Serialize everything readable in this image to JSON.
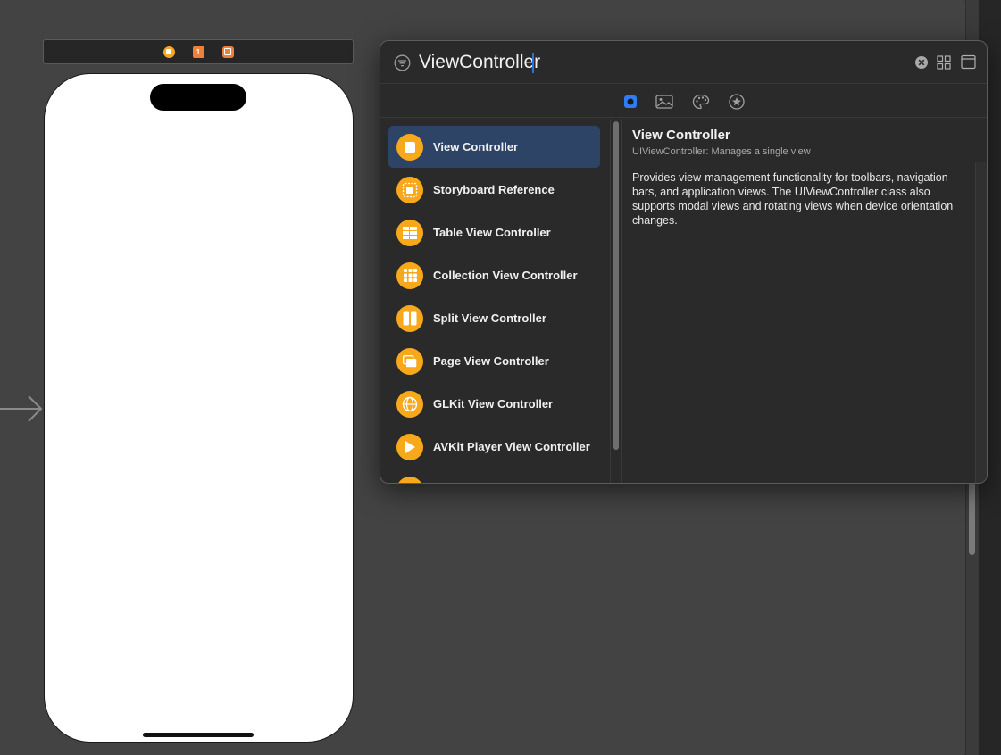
{
  "colors": {
    "accent": "#2f6fe0",
    "selection": "#2d4466",
    "object_icon": "#f7a81b",
    "canvas": "#434343",
    "panel": "#2a2a2a"
  },
  "scene_dock": {
    "icons": [
      "view-controller-icon",
      "first-responder-icon",
      "exit-icon"
    ],
    "first_responder_glyph": "1"
  },
  "library": {
    "search": {
      "value": "ViewController",
      "icon": "filter-icon"
    },
    "header_icons": [
      "clear-icon",
      "grid-icon",
      "panel-icon"
    ],
    "tabs": [
      {
        "name": "objects",
        "icon": "objects-icon",
        "active": true
      },
      {
        "name": "media",
        "icon": "photo-icon",
        "active": false
      },
      {
        "name": "colors",
        "icon": "palette-icon",
        "active": false
      },
      {
        "name": "snippets",
        "icon": "star-icon",
        "active": false
      }
    ],
    "items": [
      {
        "label": "View Controller",
        "icon": "view-controller-icon",
        "selected": true
      },
      {
        "label": "Storyboard Reference",
        "icon": "storyboard-reference-icon",
        "selected": false
      },
      {
        "label": "Table View Controller",
        "icon": "table-view-icon",
        "selected": false
      },
      {
        "label": "Collection View Controller",
        "icon": "collection-view-icon",
        "selected": false
      },
      {
        "label": "Split View Controller",
        "icon": "split-view-icon",
        "selected": false
      },
      {
        "label": "Page View Controller",
        "icon": "page-view-icon",
        "selected": false
      },
      {
        "label": "GLKit View Controller",
        "icon": "glkit-icon",
        "selected": false
      },
      {
        "label": "AVKit Player View Controller",
        "icon": "play-icon",
        "selected": false
      }
    ],
    "detail": {
      "title": "View Controller",
      "subtitle": "UIViewController: Manages a single view",
      "description": "Provides view-management functionality for toolbars, navigation bars, and application views. The UIViewController class also supports modal views and rotating views when device orientation changes."
    }
  }
}
